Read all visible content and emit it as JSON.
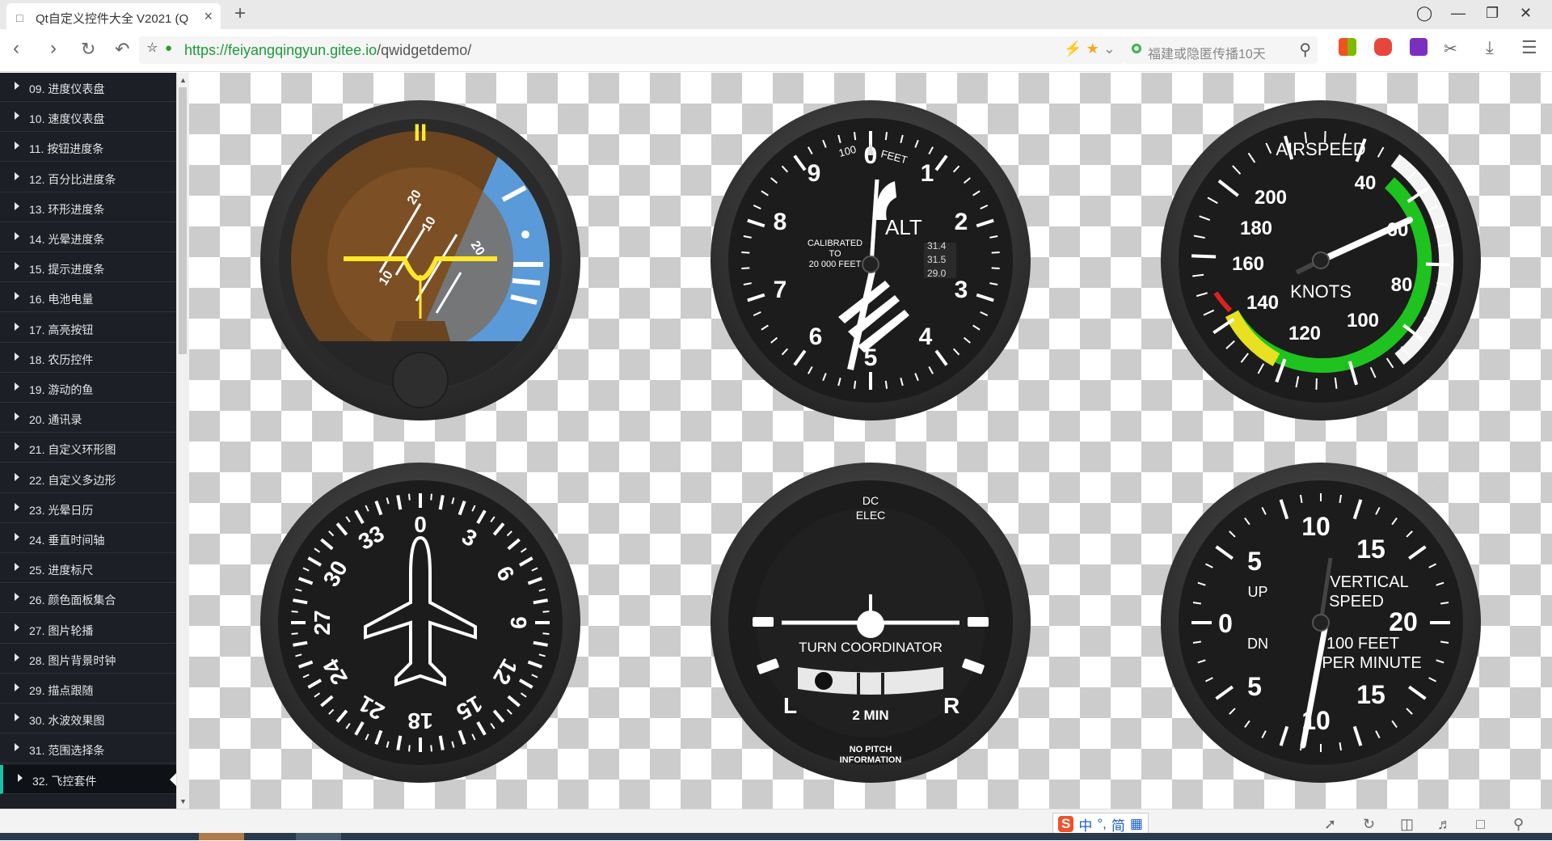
{
  "browser": {
    "tab_title": "Qt自定义控件大全 V2021 (Q",
    "tab_close": "×",
    "new_tab": "+",
    "url_host": "https://feiyangqingyun.gitee.io",
    "url_path": "/qwidgetdemo/",
    "search_placeholder": "福建或隐匿传播10天"
  },
  "sidebar": {
    "items": [
      {
        "label": "09. 进度仪表盘"
      },
      {
        "label": "10. 速度仪表盘"
      },
      {
        "label": "11. 按钮进度条"
      },
      {
        "label": "12. 百分比进度条"
      },
      {
        "label": "13. 环形进度条"
      },
      {
        "label": "14. 光晕进度条"
      },
      {
        "label": "15. 提示进度条"
      },
      {
        "label": "16. 电池电量"
      },
      {
        "label": "17. 高亮按钮"
      },
      {
        "label": "18. 农历控件"
      },
      {
        "label": "19. 游动的鱼"
      },
      {
        "label": "20. 通讯录"
      },
      {
        "label": "21. 自定义环形图"
      },
      {
        "label": "22. 自定义多边形"
      },
      {
        "label": "23. 光晕日历"
      },
      {
        "label": "24. 垂直时间轴"
      },
      {
        "label": "25. 进度标尺"
      },
      {
        "label": "26. 颜色面板集合"
      },
      {
        "label": "27. 图片轮播"
      },
      {
        "label": "28. 图片背景时钟"
      },
      {
        "label": "29. 描点跟随"
      },
      {
        "label": "30. 水波效果图"
      },
      {
        "label": "31. 范围选择条"
      },
      {
        "label": "32. 飞控套件"
      }
    ],
    "selected_index": 23
  },
  "gauges": {
    "attitude": {
      "pitch_labels": [
        "20",
        "10",
        "10",
        "20"
      ],
      "roll_marks": "II"
    },
    "altimeter": {
      "numbers": [
        "0",
        "1",
        "2",
        "3",
        "4",
        "5",
        "6",
        "7",
        "8",
        "9"
      ],
      "label_100": "100",
      "label_feet": "FEET",
      "label_alt": "ALT",
      "calibrated": [
        "CALIBRATED",
        "TO",
        "20 000 FEET"
      ],
      "kollsman": [
        "31.4",
        "31.5",
        "29.0"
      ]
    },
    "airspeed": {
      "title": "AIRSPEED",
      "unit": "KNOTS",
      "numbers": [
        "40",
        "60",
        "80",
        "100",
        "120",
        "140",
        "160",
        "180",
        "200"
      ]
    },
    "heading": {
      "numbers": [
        "0",
        "3",
        "6",
        "9",
        "12",
        "15",
        "18",
        "21",
        "24",
        "27",
        "30",
        "33"
      ]
    },
    "turn_coordinator": {
      "top": [
        "DC",
        "ELEC"
      ],
      "title": "TURN COORDINATOR",
      "left": "L",
      "right": "R",
      "min": "2 MIN",
      "bottom": [
        "NO PITCH",
        "INFORMATION"
      ]
    },
    "vsi": {
      "top": "10",
      "bottom": "10",
      "upper": [
        "5",
        "15"
      ],
      "lower": [
        "5",
        "15"
      ],
      "zero": "0",
      "twenty": "20",
      "up": "UP",
      "dn": "DN",
      "title": [
        "VERTICAL",
        "SPEED"
      ],
      "unit": [
        "100 FEET",
        "PER MINUTE"
      ]
    }
  },
  "status": {
    "ime": [
      "S",
      "中",
      "°,",
      "简",
      "▦"
    ]
  },
  "colors": {
    "sidebar_bg": "#1c1f26",
    "selected_accent": "#19c2a6",
    "ground": "#6b4420",
    "sky": "#5a9ad8",
    "airspeed_green": "#1fc31f",
    "airspeed_yellow": "#e8e020",
    "airspeed_red": "#e02020",
    "attitude_yellow": "#ffe82a"
  }
}
